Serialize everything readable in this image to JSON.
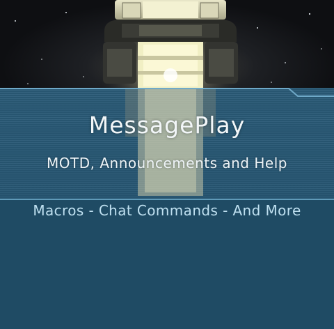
{
  "banner": {
    "title": "MessagePlay",
    "subtitle": "MOTD, Announcements and Help",
    "tagline": "Macros - Chat Commands - And More"
  },
  "colors": {
    "space": "#0e0f12",
    "banner_blue": "#2a5b78",
    "lower_blue": "#1f4b64",
    "divider": "#5f9ab8",
    "tagline": "#bfe0f0",
    "engine_glow": "#f1efc4"
  },
  "icons": [
    "spaceship-engine-artwork"
  ]
}
